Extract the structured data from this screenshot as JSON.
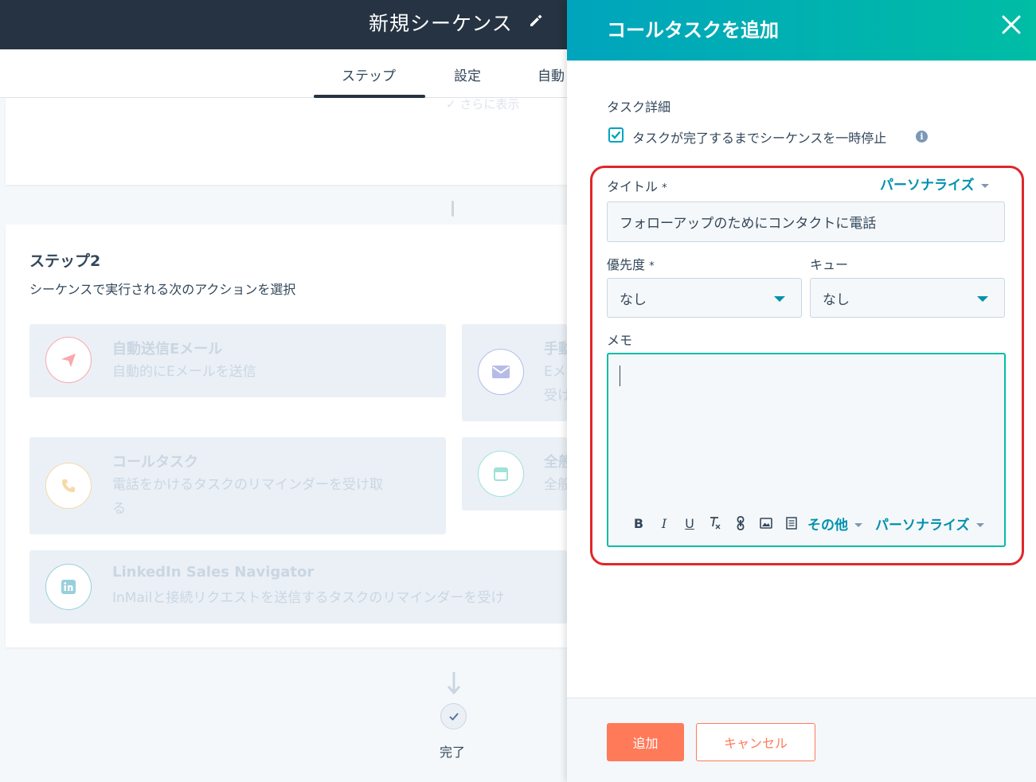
{
  "app": {
    "sequence_title": "新規シーケンス",
    "tabs": [
      "ステップ",
      "設定",
      "自動"
    ],
    "faded_text": "✓ さらに表示"
  },
  "step2": {
    "title": "ステップ2",
    "subtitle": "シーケンスで実行される次のアクションを選択",
    "options": [
      {
        "title": "自動送信Eメール",
        "desc": "自動的にEメールを送信",
        "icon": "paper-plane-icon",
        "color": "#f2545b"
      },
      {
        "title": "手動",
        "desc_line1": "Eメ",
        "desc_line2": "受け",
        "icon": "envelope-icon",
        "color": "#6a78d1"
      },
      {
        "title": "コールタスク",
        "desc_line1": "電話をかけるタスクのリマインダーを受け取",
        "desc_line2": "る",
        "icon": "phone-icon",
        "color": "#f5c26b"
      },
      {
        "title": "全般",
        "desc": "全般",
        "icon": "calendar-icon",
        "color": "#00bda5"
      },
      {
        "title": "LinkedIn Sales Navigator",
        "desc": "InMailと接続リクエストを送信するタスクのリマインダーを受け",
        "icon": "linkedin-icon",
        "color": "#0091ae"
      }
    ]
  },
  "complete_label": "完了",
  "panel": {
    "title": "コールタスクを追加",
    "task_details_label": "タスク詳細",
    "pause_checkbox_label": "タスクが完了するまでシーケンスを一時停止",
    "pause_checked": true,
    "title_label": "タイトル",
    "required_mark": "*",
    "personalize_label": "パーソナライズ",
    "title_value": "フォローアップのためにコンタクトに電話",
    "priority_label": "優先度",
    "priority_value": "なし",
    "queue_label": "キュー",
    "queue_value": "なし",
    "memo_label": "メモ",
    "memo_value": "",
    "toolbar": {
      "bold": "B",
      "italic": "I",
      "underline": "U",
      "clear_format": "T",
      "more_label": "その他",
      "personalize_label": "パーソナライズ"
    },
    "add_button": "追加",
    "cancel_button": "キャンセル"
  },
  "colors": {
    "header_gradient_start": "#00a4bd",
    "header_gradient_end": "#00bda5",
    "topbar": "#253342",
    "primary_button": "#ff7a59",
    "link": "#0091ae",
    "highlight_box": "#e0262b"
  }
}
